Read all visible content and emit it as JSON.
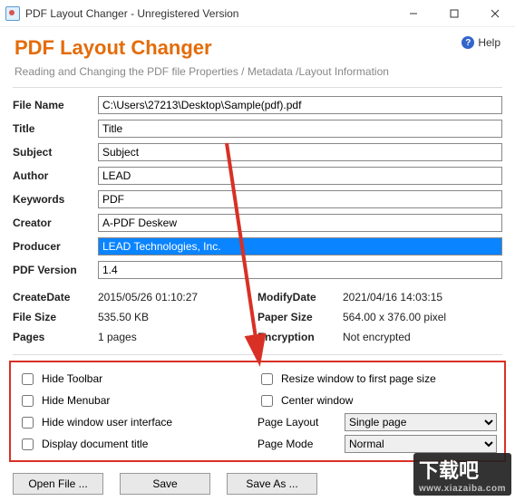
{
  "window": {
    "title": "PDF Layout Changer - Unregistered Version"
  },
  "header": {
    "brand": "PDF Layout Changer",
    "tagline": "Reading and Changing the PDF file Properties / Metadata /Layout Information",
    "help_label": "Help",
    "help_glyph": "?"
  },
  "fields": {
    "file_name_label": "File Name",
    "file_name_value": "C:\\Users\\27213\\Desktop\\Sample(pdf).pdf",
    "title_label": "Title",
    "title_value": "Title",
    "subject_label": "Subject",
    "subject_value": "Subject",
    "author_label": "Author",
    "author_value": "LEAD",
    "keywords_label": "Keywords",
    "keywords_value": "PDF",
    "creator_label": "Creator",
    "creator_value": "A-PDF Deskew",
    "producer_label": "Producer",
    "producer_value": "LEAD Technologies, Inc.",
    "pdfversion_label": "PDF Version",
    "pdfversion_value": "1.4"
  },
  "info": {
    "createdate_label": "CreateDate",
    "createdate_value": "2015/05/26 01:10:27",
    "modifydate_label": "ModifyDate",
    "modifydate_value": "2021/04/16 14:03:15",
    "filesize_label": "File Size",
    "filesize_value": "535.50 KB",
    "papersize_label": "Paper Size",
    "papersize_value": "564.00 x 376.00 pixel",
    "pages_label": "Pages",
    "pages_value": "1 pages",
    "encryption_label": "Encryption",
    "encryption_value": "Not encrypted"
  },
  "options": {
    "hide_toolbar": "Hide Toolbar",
    "hide_menubar": "Hide Menubar",
    "hide_wui": "Hide window user interface",
    "display_doc_title": "Display document title",
    "resize_window": "Resize window to first page size",
    "center_window": "Center window",
    "page_layout_label": "Page Layout",
    "page_layout_value": "Single page",
    "page_mode_label": "Page Mode",
    "page_mode_value": "Normal"
  },
  "buttons": {
    "open": "Open File ...",
    "save": "Save",
    "saveas": "Save As ..."
  },
  "watermark": {
    "main": "下载吧",
    "sub": "www.xiazaiba.com"
  }
}
